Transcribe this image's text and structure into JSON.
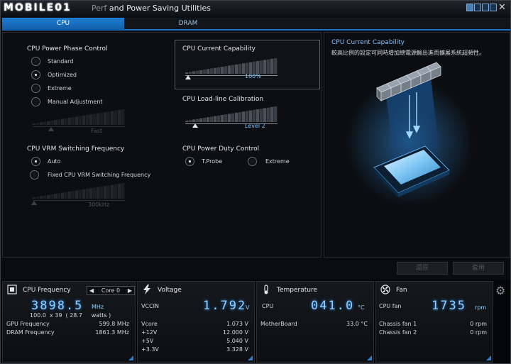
{
  "titlebar": {
    "logo_text": "MOBILE01",
    "title_faded": "Perf",
    "title": "and Power Saving Utilities",
    "close": "✕"
  },
  "tabs": [
    {
      "label": "CPU",
      "active": true
    },
    {
      "label": "DRAM",
      "active": false
    }
  ],
  "phase": {
    "title": "CPU Power Phase Control",
    "options": [
      {
        "label": "Standard",
        "selected": false
      },
      {
        "label": "Optimized",
        "selected": true
      },
      {
        "label": "Extreme",
        "selected": false
      },
      {
        "label": "Manual Adjustment",
        "selected": false
      }
    ],
    "slider_value": "Fast",
    "slider_level": 0.2
  },
  "vrm": {
    "title": "CPU VRM Switching Frequency",
    "options": [
      {
        "label": "Auto",
        "selected": true
      },
      {
        "label": "Fixed CPU VRM Switching Frequency",
        "selected": false
      }
    ],
    "slider_value": "300kHz",
    "slider_level": 0.0
  },
  "current": {
    "title": "CPU Current Capability",
    "slider_value": "100%",
    "slider_level": 0.0
  },
  "loadline": {
    "title": "CPU Load-line Calibration",
    "slider_value": "Level 2",
    "slider_level": 0.12
  },
  "duty": {
    "title": "CPU Power Duty Control",
    "options": [
      {
        "label": "T.Probe",
        "selected": true
      },
      {
        "label": "Extreme",
        "selected": false
      }
    ]
  },
  "side": {
    "title": "CPU Current Capability",
    "description": "較高比例的設定可同時增加總電源輸出進而擴展系統超頻性。"
  },
  "buttons": {
    "undo": "還原",
    "apply": "套用"
  },
  "freq": {
    "title": "CPU Frequency",
    "core_select": "Core 0",
    "big_value": "3898.5",
    "big_unit": "MHz",
    "ratio_line": "100.0  x 39  ( 28.7     watts )",
    "rows": [
      {
        "label": "GPU Frequency",
        "value": "599.8  MHz"
      },
      {
        "label": "DRAM Frequency",
        "value": "1861.3  MHz"
      }
    ]
  },
  "voltage": {
    "title": "Voltage",
    "main_label": "VCCIN",
    "big_value": "1.792",
    "big_unit": "V",
    "rows": [
      {
        "label": "Vcore",
        "value": "1.073  V"
      },
      {
        "label": "+12V",
        "value": "12.000  V"
      },
      {
        "label": "+5V",
        "value": "5.040  V"
      },
      {
        "label": "+3.3V",
        "value": "3.328  V"
      }
    ]
  },
  "temperature": {
    "title": "Temperature",
    "main_label": "CPU",
    "big_value": "041.0",
    "big_unit": "°C",
    "rows": [
      {
        "label": "MotherBoard",
        "value": "33.0 °C"
      }
    ]
  },
  "fan": {
    "title": "Fan",
    "main_label": "CPU fan",
    "big_value": "1735",
    "big_unit": "rpm",
    "rows": [
      {
        "label": "Chassis fan 1",
        "value": "0  rpm"
      },
      {
        "label": "Chassis fan 2",
        "value": "0  rpm"
      }
    ]
  },
  "colors": {
    "accent": "#1c72c4",
    "digits": "#8fd0ff"
  }
}
